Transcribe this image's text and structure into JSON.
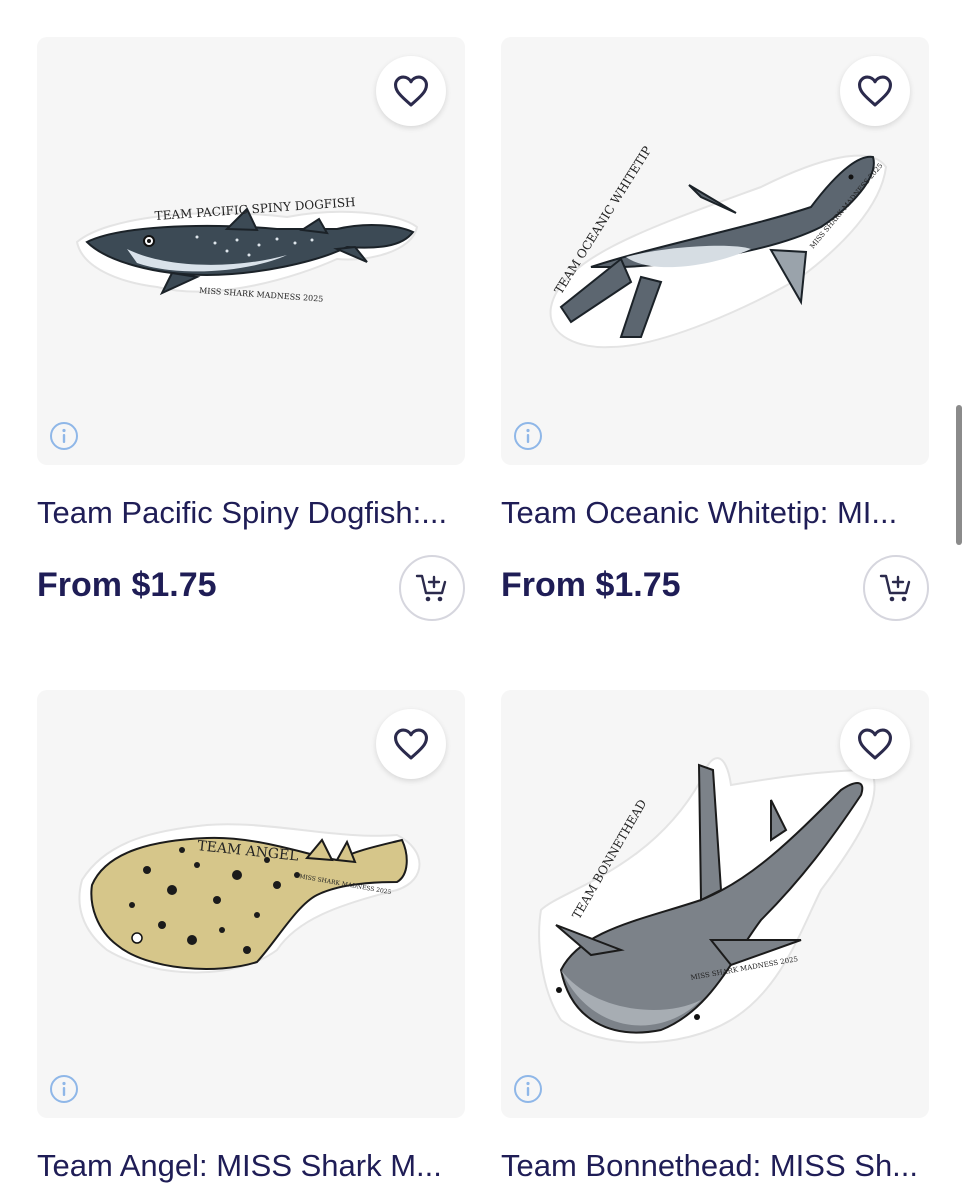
{
  "products": [
    {
      "title": "Team Pacific Spiny Dogfish:...",
      "price": "From $1.75",
      "sticker": {
        "team": "TEAM PACIFIC SPINY DOGFISH",
        "event": "MISS SHARK MADNESS 2025"
      }
    },
    {
      "title": "Team Oceanic Whitetip: MI...",
      "price": "From $1.75",
      "sticker": {
        "team": "TEAM OCEANIC WHITETIP",
        "event": "MISS SHARK MADNESS 2025"
      }
    },
    {
      "title": "Team Angel: MISS Shark M...",
      "price": "",
      "sticker": {
        "team": "TEAM ANGEL",
        "event": "MISS SHARK MADNESS 2025"
      }
    },
    {
      "title": "Team Bonnethead: MISS Sh...",
      "price": "",
      "sticker": {
        "team": "TEAM BONNETHEAD",
        "event": "MISS SHARK MADNESS 2025"
      }
    }
  ],
  "icons": {
    "favorite": "heart-outline-icon",
    "info": "info-circle-icon",
    "cart": "add-to-cart-icon"
  },
  "colors": {
    "text": "#1f1d56",
    "card_bg": "#f6f6f6",
    "info_icon": "#8fb7e8"
  }
}
